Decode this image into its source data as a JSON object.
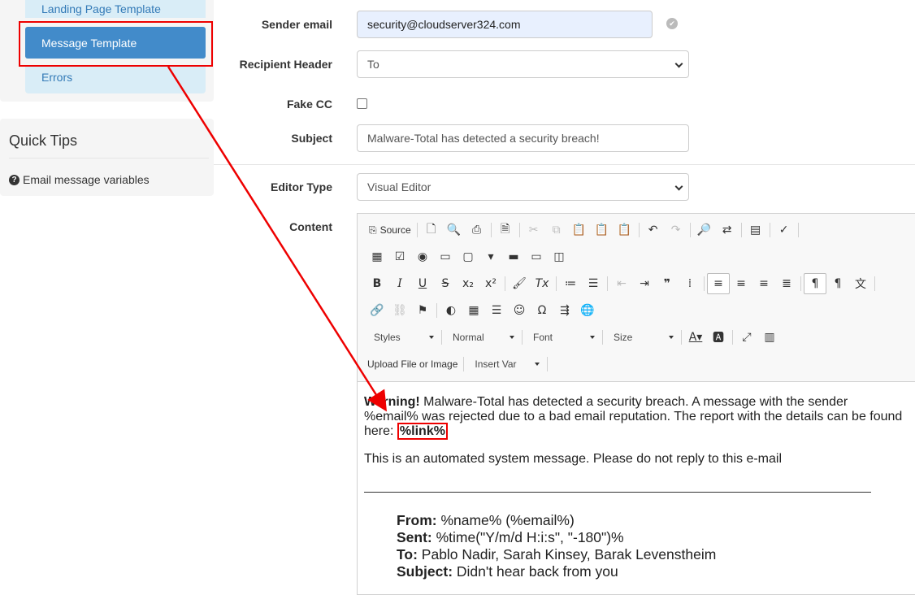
{
  "sidebar": {
    "items": [
      {
        "label": "Landing Page Template"
      },
      {
        "label": "Message Template"
      },
      {
        "label": "Errors"
      }
    ]
  },
  "quick_tips": {
    "title": "Quick Tips",
    "link": "Email message variables"
  },
  "form": {
    "sender_email_label": "Sender email",
    "sender_email_value": "security@cloudserver324.com",
    "recipient_header_label": "Recipient Header",
    "recipient_header_value": "To",
    "fake_cc_label": "Fake CC",
    "fake_cc_checked": false,
    "subject_label": "Subject",
    "subject_value": "Malware-Total has detected a security breach!",
    "editor_type_label": "Editor Type",
    "editor_type_value": "Visual Editor",
    "content_label": "Content"
  },
  "editor": {
    "toolbar": {
      "source_label": "Source",
      "styles_label": "Styles",
      "format_label": "Normal",
      "font_label": "Font",
      "size_label": "Size",
      "upload_label": "Upload File or Image",
      "insert_var_label": "Insert Var"
    },
    "content": {
      "warning_bold": "Warning!",
      "warning_text": " Malware-Total has detected a security breach. A message with the sender %email% was rejected due to a bad email reputation. The report with the details can be found here: ",
      "link_var": "%link%",
      "automated_text": "This is an automated system message. Please do not reply to this e-mail",
      "from_label": "From:",
      "from_value": " %name% (%email%)",
      "sent_label": "Sent:",
      "sent_value": " %time(\"Y/m/d H:i:s\", \"-180\")%",
      "to_label": "To:",
      "to_value": " Pablo Nadir, Sarah Kinsey, Barak Levenstheim",
      "subject_label": "Subject:",
      "subject_value": " Didn't hear back from you"
    }
  },
  "colors": {
    "active_item": "#428bca",
    "sub_item_bg": "#d9edf7",
    "annotation_red": "#e00000"
  }
}
